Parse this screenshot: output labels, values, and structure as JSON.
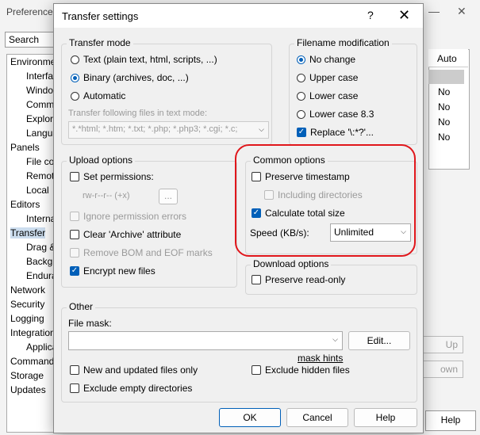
{
  "background": {
    "title": "Preferences",
    "search_label": "Search",
    "tree": [
      {
        "label": "Environment",
        "child": false
      },
      {
        "label": "Interface",
        "child": true
      },
      {
        "label": "Windows",
        "child": true
      },
      {
        "label": "Commander",
        "child": true
      },
      {
        "label": "Explorer",
        "child": true
      },
      {
        "label": "Languages",
        "child": true
      },
      {
        "label": "Panels",
        "child": false
      },
      {
        "label": "File colors",
        "child": true
      },
      {
        "label": "Remote",
        "child": true
      },
      {
        "label": "Local",
        "child": true
      },
      {
        "label": "Editors",
        "child": false
      },
      {
        "label": "Internal editor",
        "child": true
      },
      {
        "label": "Transfer",
        "child": false
      },
      {
        "label": "Drag & Drop",
        "child": true
      },
      {
        "label": "Background",
        "child": true
      },
      {
        "label": "Endurance",
        "child": true
      },
      {
        "label": "Network",
        "child": false
      },
      {
        "label": "Security",
        "child": false
      },
      {
        "label": "Logging",
        "child": false
      },
      {
        "label": "Integration",
        "child": false
      },
      {
        "label": "Applications",
        "child": true
      },
      {
        "label": "Commands",
        "child": false
      },
      {
        "label": "Storage",
        "child": false
      },
      {
        "label": "Updates",
        "child": false
      }
    ],
    "selected_tree_item": "Transfer",
    "right_column_header": "Auto",
    "right_column_values": [
      "No",
      "No",
      "No",
      "No"
    ],
    "up_button": "Up",
    "down_button": "own",
    "help_button": "Help",
    "minimize": "—",
    "close": "✕"
  },
  "dialog": {
    "title": "Transfer settings",
    "help_icon": "?",
    "close_icon": "✕",
    "transfer_mode": {
      "title": "Transfer mode",
      "options": [
        "Text (plain text, html, scripts, ...)",
        "Binary (archives, doc, ...)",
        "Automatic"
      ],
      "selected": 1,
      "text_mode_label": "Transfer following files in text mode:",
      "text_mode_value": "*.*html; *.htm; *.txt; *.php; *.php3; *.cgi; *.c;"
    },
    "filename_modification": {
      "title": "Filename modification",
      "options": [
        "No change",
        "Upper case",
        "Lower case",
        "Lower case 8.3"
      ],
      "selected": 0,
      "replace_label": "Replace '\\:*?'...",
      "replace_checked": true
    },
    "upload_options": {
      "title": "Upload options",
      "set_permissions": "Set permissions:",
      "permissions_value": "rw-r--r-- (+x)",
      "permissions_button": "...",
      "ignore_errors": "Ignore permission errors",
      "clear_archive": "Clear 'Archive' attribute",
      "remove_bom": "Remove BOM and EOF marks",
      "encrypt_files": "Encrypt new files"
    },
    "common_options": {
      "title": "Common options",
      "preserve_timestamp": "Preserve timestamp",
      "including_directories": "Including directories",
      "calculate_total_size": "Calculate total size",
      "speed_label": "Speed (KB/s):",
      "speed_value": "Unlimited"
    },
    "download_options": {
      "title": "Download options",
      "preserve_readonly": "Preserve read-only"
    },
    "other": {
      "title": "Other",
      "file_mask_label": "File mask:",
      "file_mask_value": "",
      "edit_button": "Edit...",
      "mask_hints": "mask hints",
      "new_updated_only": "New and updated files only",
      "exclude_hidden": "Exclude hidden files",
      "exclude_empty_dirs": "Exclude empty directories"
    },
    "buttons": {
      "ok": "OK",
      "cancel": "Cancel",
      "help": "Help"
    }
  },
  "annotation_color": "#e0161b"
}
